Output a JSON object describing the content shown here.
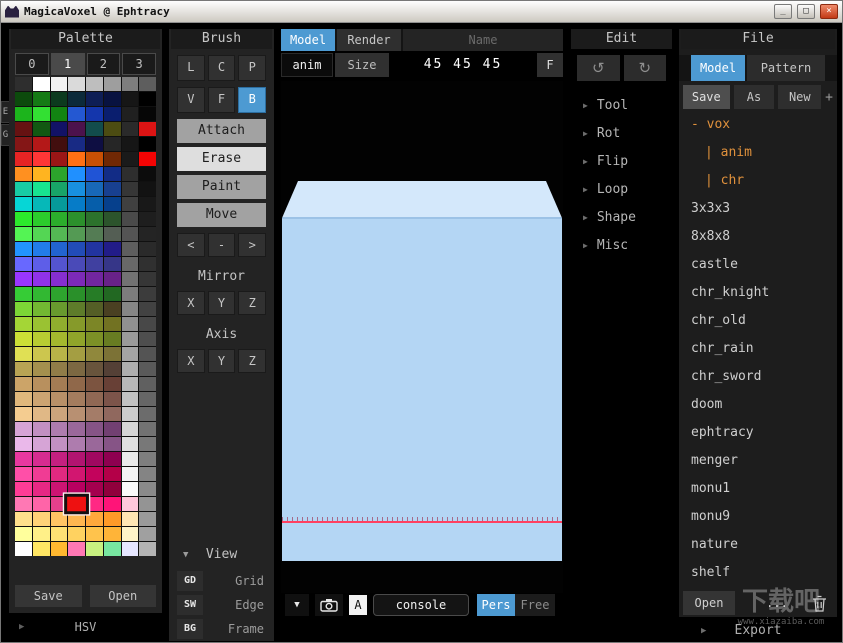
{
  "window": {
    "title": "MagicaVoxel @ Ephtracy",
    "minimize_label": "_",
    "maximize_label": "□",
    "close_label": "×"
  },
  "icons": {
    "dropdown": "▼",
    "chevron_right": "▶",
    "undo": "↺",
    "redo": "↻"
  },
  "palette": {
    "header": "Palette",
    "tabs": [
      "0",
      "1",
      "2",
      "3"
    ],
    "active_tab_index": 1,
    "side_tabs": [
      "E",
      "G"
    ],
    "selected_cell": {
      "row": 28,
      "col": 3
    },
    "save_label": "Save",
    "open_label": "Open",
    "hsv_label": "HSV",
    "rows": [
      [
        "#2e2e2e",
        "#ffffff",
        "#f2f2f2",
        "#dadada",
        "#bebebe",
        "#9e9e9e",
        "#7e7e7e",
        "#5e5e5e"
      ],
      [
        "#0c4a0c",
        "#157a15",
        "#0c3a1e",
        "#0c2a3a",
        "#0e1e55",
        "#081240",
        "#161616",
        "#000000"
      ],
      [
        "#1cb41c",
        "#33e033",
        "#128412",
        "#2458d2",
        "#1436ac",
        "#0a1e6e",
        "#202020",
        "#060606"
      ],
      [
        "#661212",
        "#125812",
        "#121266",
        "#4c124c",
        "#124c4c",
        "#4c4c12",
        "#2a2a2a",
        "#dc1414"
      ],
      [
        "#841616",
        "#b41818",
        "#420e0e",
        "#182a84",
        "#0e0e42",
        "#262626",
        "#161616",
        "#000000"
      ],
      [
        "#e62424",
        "#ff3636",
        "#9a1616",
        "#ff7014",
        "#c85004",
        "#702804",
        "#1a1a1a",
        "#f40404"
      ],
      [
        "#ff9020",
        "#ffb420",
        "#2ca42c",
        "#2090ff",
        "#2054d6",
        "#122c86",
        "#2e2e2e",
        "#0c0c0c"
      ],
      [
        "#18cca4",
        "#18e490",
        "#18a468",
        "#1890e0",
        "#1868b8",
        "#184090",
        "#363636",
        "#121212"
      ],
      [
        "#06d6d6",
        "#06b8b8",
        "#069a9a",
        "#067cc8",
        "#065eaa",
        "#06408c",
        "#404040",
        "#181818"
      ],
      [
        "#2cea2c",
        "#2ccc2c",
        "#2cae2c",
        "#2c902c",
        "#2c722c",
        "#2c542c",
        "#4a4a4a",
        "#1e1e1e"
      ],
      [
        "#54f454",
        "#54d654",
        "#54b854",
        "#549a54",
        "#547c54",
        "#545e54",
        "#545454",
        "#242424"
      ],
      [
        "#2294ff",
        "#227ce8",
        "#2264d0",
        "#224cb8",
        "#2234a0",
        "#221c88",
        "#5e5e5e",
        "#2a2a2a"
      ],
      [
        "#6868ff",
        "#5e5ee8",
        "#5454d0",
        "#4a4ab8",
        "#4040a0",
        "#363688",
        "#686868",
        "#303030"
      ],
      [
        "#9a36ff",
        "#9032e8",
        "#862ed0",
        "#7c2ab8",
        "#7226a0",
        "#682288",
        "#727272",
        "#363636"
      ],
      [
        "#36cc36",
        "#32b832",
        "#2ea42e",
        "#2a902a",
        "#267c26",
        "#226822",
        "#7c7c7c",
        "#3c3c3c"
      ],
      [
        "#7cd636",
        "#72b832",
        "#689a2e",
        "#5e7c2a",
        "#545e26",
        "#4a4022",
        "#868686",
        "#424242"
      ],
      [
        "#a4d636",
        "#9ac232",
        "#90ae2e",
        "#869a2a",
        "#7c8626",
        "#727222",
        "#909090",
        "#484848"
      ],
      [
        "#cce036",
        "#b8cc32",
        "#a4b82e",
        "#90a42a",
        "#7c9026",
        "#687c22",
        "#9a9a9a",
        "#4e4e4e"
      ],
      [
        "#e0e054",
        "#ccc64e",
        "#b8b448",
        "#a49e42",
        "#90883c",
        "#7c7236",
        "#a4a4a4",
        "#545454"
      ],
      [
        "#b8a454",
        "#a4904e",
        "#907c48",
        "#7c6842",
        "#68543c",
        "#544036",
        "#aeaeae",
        "#5a5a5a"
      ],
      [
        "#cca468",
        "#b8905e",
        "#a47c54",
        "#90684a",
        "#7c5440",
        "#684036",
        "#b8b8b8",
        "#606060"
      ],
      [
        "#e0b87c",
        "#cca472",
        "#b89068",
        "#a47c5e",
        "#906854",
        "#7c544a",
        "#c2c2c2",
        "#666666"
      ],
      [
        "#f4cc90",
        "#e0b886",
        "#cca47c",
        "#b89072",
        "#a47c68",
        "#90685e",
        "#cccccc",
        "#6c6c6c"
      ],
      [
        "#d6a4d6",
        "#c290c2",
        "#ae7cae",
        "#9a689a",
        "#865486",
        "#724072",
        "#d6d6d6",
        "#727272"
      ],
      [
        "#eab8ea",
        "#d6a4d6",
        "#c290c2",
        "#ae7cae",
        "#9a689a",
        "#865486",
        "#e0e0e0",
        "#787878"
      ],
      [
        "#e838a0",
        "#d62c90",
        "#c42080",
        "#b21470",
        "#a00860",
        "#8e0050",
        "#eaeaea",
        "#7e7e7e"
      ],
      [
        "#ff4fa8",
        "#f03c94",
        "#e12980",
        "#d21670",
        "#c3035c",
        "#b40048",
        "#f4f4f4",
        "#848484"
      ],
      [
        "#ff3c96",
        "#e62884",
        "#cc1472",
        "#b80060",
        "#a4004e",
        "#90003c",
        "#fafafa",
        "#8a8a8a"
      ],
      [
        "#ff78b4",
        "#ff64a8",
        "#e6408c",
        "#ee1111",
        "#ff2884",
        "#ff1478",
        "#ffc8dc",
        "#949494"
      ],
      [
        "#ffe08c",
        "#ffd278",
        "#ffc464",
        "#ffb650",
        "#ffa83c",
        "#ff9a28",
        "#ffe6b4",
        "#9a9a9a"
      ],
      [
        "#ffff9c",
        "#fff088",
        "#ffe174",
        "#ffd260",
        "#ffc34c",
        "#ffb438",
        "#fff4c8",
        "#a0a0a0"
      ],
      [
        "#ffffff",
        "#ffe664",
        "#ffb830",
        "#ff78b4",
        "#c8f080",
        "#78e6a0",
        "#e6e6ff",
        "#b4b4b4"
      ]
    ]
  },
  "brush": {
    "header": "Brush",
    "modes_row1": [
      "L",
      "C",
      "P"
    ],
    "modes_row2": [
      "V",
      "F",
      "B"
    ],
    "active_mode": "B",
    "tools": [
      "Attach",
      "Erase",
      "Paint",
      "Move"
    ],
    "active_tool": "Erase",
    "nav_buttons": [
      "<",
      "-",
      ">"
    ],
    "mirror": {
      "label": "Mirror",
      "axes": [
        "X",
        "Y",
        "Z"
      ]
    },
    "axis": {
      "label": "Axis",
      "axes": [
        "X",
        "Y",
        "Z"
      ]
    },
    "view": {
      "label": "View",
      "rows": [
        {
          "key": "GD",
          "label": "Grid"
        },
        {
          "key": "SW",
          "label": "Edge"
        },
        {
          "key": "BG",
          "label": "Frame"
        }
      ]
    }
  },
  "canvas": {
    "tabs": [
      "Model",
      "Render"
    ],
    "active_tab": "Model",
    "name_placeholder": "Name",
    "anim_label": "anim",
    "size_label": "Size",
    "size_value": "45 45 45",
    "frame_toggle": "F",
    "toolbar": {
      "console": "console",
      "a_button": "A",
      "projection_active": "Pers",
      "projection_inactive": "Free"
    }
  },
  "edit": {
    "header": "Edit",
    "items": [
      "Tool",
      "Rot",
      "Flip",
      "Loop",
      "Shape",
      "Misc"
    ]
  },
  "file": {
    "header": "File",
    "tabs": [
      "Model",
      "Pattern"
    ],
    "active_tab": "Model",
    "actions": [
      "Save",
      "As",
      "New"
    ],
    "add_button": "+",
    "list": [
      {
        "label": "- vox",
        "kind": "root"
      },
      {
        "label": "| anim",
        "kind": "child"
      },
      {
        "label": "| chr",
        "kind": "child"
      },
      {
        "label": "3x3x3",
        "kind": "item"
      },
      {
        "label": "8x8x8",
        "kind": "item"
      },
      {
        "label": "castle",
        "kind": "item"
      },
      {
        "label": "chr_knight",
        "kind": "item"
      },
      {
        "label": "chr_old",
        "kind": "item"
      },
      {
        "label": "chr_rain",
        "kind": "item"
      },
      {
        "label": "chr_sword",
        "kind": "item"
      },
      {
        "label": "doom",
        "kind": "item"
      },
      {
        "label": "ephtracy",
        "kind": "item"
      },
      {
        "label": "menger",
        "kind": "item"
      },
      {
        "label": "monu1",
        "kind": "item"
      },
      {
        "label": "monu9",
        "kind": "item"
      },
      {
        "label": "nature",
        "kind": "item"
      },
      {
        "label": "shelf",
        "kind": "item"
      }
    ],
    "open_label": "Open",
    "more_label": "...",
    "export_label": "Export"
  },
  "watermark": {
    "line1": "下载吧",
    "line2": "www.xiazaiba.com"
  },
  "colors": {
    "accent": "#4d9ad2",
    "orange": "#e0913c",
    "vox_top": "#d4e8fb",
    "vox_front": "#b4d6f4",
    "vox_edge": "#9cc2e6",
    "red_line": "#ff4060"
  }
}
